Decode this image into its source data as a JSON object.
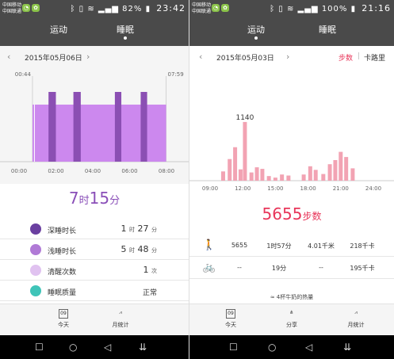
{
  "left": {
    "statusbar": {
      "carrier_1": "中国移动",
      "carrier_2": "中国联通",
      "battery": "82%",
      "time": "23:42"
    },
    "tabs": [
      {
        "label": "运动"
      },
      {
        "label": "睡眠"
      }
    ],
    "date": "2015年05月06日",
    "sleep_total": {
      "hours": "7",
      "hours_unit": "时",
      "minutes": "15",
      "minutes_unit": "分"
    },
    "rows": [
      {
        "label": "深睡时长",
        "v1": "1",
        "u1": "时",
        "v2": "27",
        "u2": "分",
        "icon": "moon-deep-icon",
        "color": "#6a3fa0"
      },
      {
        "label": "浅睡时长",
        "v1": "5",
        "u1": "时",
        "v2": "48",
        "u2": "分",
        "icon": "moon-light-icon",
        "color": "#b07ad6"
      },
      {
        "label": "清醒次数",
        "v1": "1",
        "u1": "次",
        "v2": "",
        "u2": "",
        "icon": "moon-awake-icon",
        "color": "#e0c2f0"
      },
      {
        "label": "睡眠质量",
        "v1": "正常",
        "u1": "",
        "v2": "",
        "u2": "",
        "icon": "smile-icon",
        "color": "#3fc4b8"
      }
    ],
    "bottom": [
      {
        "label": "今天",
        "icon_text": "09"
      },
      {
        "label": "月统计",
        "icon_text": ""
      }
    ],
    "chart_data": {
      "type": "bar",
      "start_label": "00:44",
      "end_label": "07:59",
      "xticks": [
        "00:00",
        "02:00",
        "04:00",
        "06:00",
        "08:00"
      ],
      "x_range_hours": [
        0,
        8
      ],
      "light_sleep_segments": [
        [
          0.73,
          7.98
        ]
      ],
      "deep_sleep_segments": [
        [
          1.6,
          2.0
        ],
        [
          2.95,
          3.35
        ],
        [
          5.2,
          5.55
        ],
        [
          6.6,
          6.95
        ]
      ],
      "awake_marks": [
        0.75
      ]
    }
  },
  "right": {
    "statusbar": {
      "carrier_1": "中国移动",
      "carrier_2": "中国联通",
      "battery": "100%",
      "time": "21:16"
    },
    "tabs": [
      {
        "label": "运动"
      },
      {
        "label": "睡眠"
      }
    ],
    "date": "2015年05月03日",
    "toggle": {
      "steps": "步数",
      "sep": "|",
      "calories": "卡路里"
    },
    "steps_total": {
      "value": "5655",
      "unit": "步数"
    },
    "metrics": [
      {
        "icon": "walk-icon",
        "glyph": "🚶",
        "steps": "5655",
        "duration": "1时57分",
        "distance": "4.01千米",
        "calories": "218千卡"
      },
      {
        "icon": "bike-icon",
        "glyph": "🚲",
        "steps": "--",
        "duration": "19分",
        "distance": "--",
        "calories": "195千卡"
      }
    ],
    "note": "≈ 4杯牛奶的热量",
    "bottom": [
      {
        "label": "今天",
        "icon_text": "09"
      },
      {
        "label": "分享"
      },
      {
        "label": "月统计"
      }
    ],
    "chart_data": {
      "type": "bar",
      "peak_label": "1140",
      "xticks": [
        "09:00",
        "12:00",
        "15:00",
        "18:00",
        "21:00",
        "24:00"
      ],
      "x_range_hours": [
        9,
        24
      ],
      "ylim": [
        0,
        1200
      ],
      "bars": [
        {
          "x": 10.2,
          "y": 180
        },
        {
          "x": 10.8,
          "y": 420
        },
        {
          "x": 11.3,
          "y": 650
        },
        {
          "x": 11.8,
          "y": 220
        },
        {
          "x": 12.2,
          "y": 1140
        },
        {
          "x": 12.8,
          "y": 160
        },
        {
          "x": 13.3,
          "y": 260
        },
        {
          "x": 13.8,
          "y": 230
        },
        {
          "x": 14.4,
          "y": 90
        },
        {
          "x": 15.0,
          "y": 60
        },
        {
          "x": 15.6,
          "y": 120
        },
        {
          "x": 16.2,
          "y": 100
        },
        {
          "x": 17.6,
          "y": 120
        },
        {
          "x": 18.2,
          "y": 280
        },
        {
          "x": 18.7,
          "y": 210
        },
        {
          "x": 19.4,
          "y": 130
        },
        {
          "x": 20.0,
          "y": 320
        },
        {
          "x": 20.5,
          "y": 400
        },
        {
          "x": 21.0,
          "y": 560
        },
        {
          "x": 21.5,
          "y": 460
        },
        {
          "x": 22.1,
          "y": 240
        }
      ]
    }
  },
  "colors": {
    "header": "#4a4a4a",
    "light_sleep": "#cc88ee",
    "deep_sleep": "#8b4fb3",
    "steps_bar": "#f2a3b3",
    "steps_text": "#e8365a",
    "sleep_text": "#8a4fb8"
  }
}
